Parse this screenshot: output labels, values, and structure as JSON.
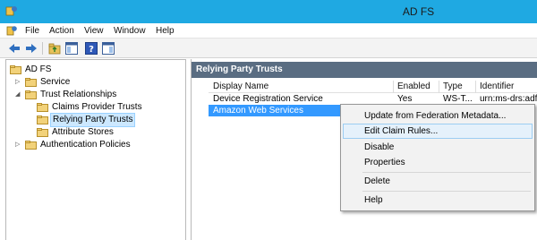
{
  "window": {
    "title": "AD FS"
  },
  "menu": [
    "File",
    "Action",
    "View",
    "Window",
    "Help"
  ],
  "toolbar": {
    "buttons": [
      "back-icon",
      "forward-icon",
      "up-folder-icon",
      "show-hide-tree-icon",
      "help-icon",
      "show-hide-action-pane-icon"
    ]
  },
  "tree": {
    "root": "AD FS",
    "service": "Service",
    "trust_relationships": "Trust Relationships",
    "claims_provider_trusts": "Claims Provider Trusts",
    "relying_party_trusts": "Relying Party Trusts",
    "attribute_stores": "Attribute Stores",
    "authentication_policies": "Authentication Policies"
  },
  "pane": {
    "title": "Relying Party Trusts",
    "columns": [
      "Display Name",
      "Enabled",
      "Type",
      "Identifier"
    ],
    "rows": [
      {
        "display_name": "Device Registration Service",
        "enabled": "Yes",
        "type": "WS-T...",
        "identifier": "urn:ms-drs:adfs.ex"
      },
      {
        "display_name": "Amazon Web Services",
        "enabled": "",
        "type": "",
        "identifier": ""
      }
    ]
  },
  "context_menu": {
    "update_metadata": "Update from Federation Metadata...",
    "edit_claim_rules": "Edit Claim Rules...",
    "disable": "Disable",
    "properties": "Properties",
    "delete": "Delete",
    "help": "Help"
  },
  "colors": {
    "titlebar": "#1fa9e2",
    "pane_header": "#5a6d82",
    "selection": "#3399ff"
  }
}
